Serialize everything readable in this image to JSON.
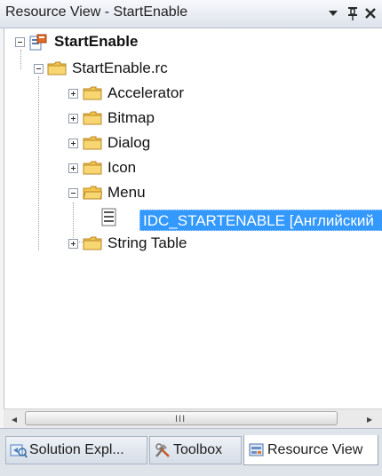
{
  "window": {
    "title": "Resource View - StartEnable",
    "buttons": {
      "dropdown_glyph": "▾",
      "pin_glyph": "ᚼ",
      "close_glyph": "✕"
    }
  },
  "tree": {
    "root": {
      "label": "StartEnable",
      "icon": "project-icon",
      "expanded": true
    },
    "rc_file": {
      "label": "StartEnable.rc",
      "icon": "folder-icon",
      "expanded": true
    },
    "folders": [
      {
        "label": "Accelerator",
        "icon": "folder-icon",
        "expanded": false
      },
      {
        "label": "Bitmap",
        "icon": "folder-icon",
        "expanded": false
      },
      {
        "label": "Dialog",
        "icon": "folder-icon",
        "expanded": false
      },
      {
        "label": "Icon",
        "icon": "folder-icon",
        "expanded": false
      },
      {
        "label": "Menu",
        "icon": "folder-icon",
        "expanded": true
      },
      {
        "label": "String Table",
        "icon": "folder-icon",
        "expanded": false
      }
    ],
    "menu_child": {
      "label": "IDC_STARTENABLE [Английский",
      "icon": "menu-resource-icon",
      "selected": true
    }
  },
  "scrollbar": {
    "left_arrow": "◂",
    "right_arrow": "▸",
    "grip": "III"
  },
  "tabs": [
    {
      "label": "Solution Expl...",
      "icon": "solution-explorer-icon",
      "active": false
    },
    {
      "label": "Toolbox",
      "icon": "toolbox-icon",
      "active": false
    },
    {
      "label": "Resource View",
      "icon": "resource-view-icon",
      "active": true
    }
  ],
  "colors": {
    "selection": "#3399ff",
    "folder": "#f2c44b",
    "title_bar": "#dde3ec"
  }
}
